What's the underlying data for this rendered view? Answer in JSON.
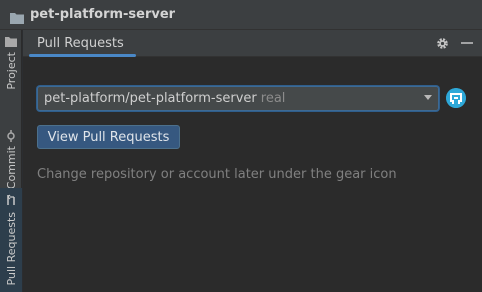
{
  "window": {
    "title": "pet-platform-server"
  },
  "side_strip": {
    "tabs": [
      {
        "label": "Project",
        "icon": "folder-icon",
        "active": false
      },
      {
        "label": "Commit",
        "icon": "commit-icon",
        "active": false
      },
      {
        "label": "Pull Requests",
        "icon": "pull-request-icon",
        "active": true
      }
    ]
  },
  "panel": {
    "tab_label": "Pull Requests",
    "header_icons": [
      "gear-icon",
      "minimize-icon"
    ],
    "repository": {
      "name": "pet-platform/pet-platform-server",
      "remote": "real"
    },
    "view_button": "View Pull Requests",
    "hint": "Change repository or account later under the gear icon"
  },
  "colors": {
    "accent": "#4a88c7",
    "button": "#365880",
    "background": "#2b2b2b",
    "avatar": "#2ea8d8"
  }
}
